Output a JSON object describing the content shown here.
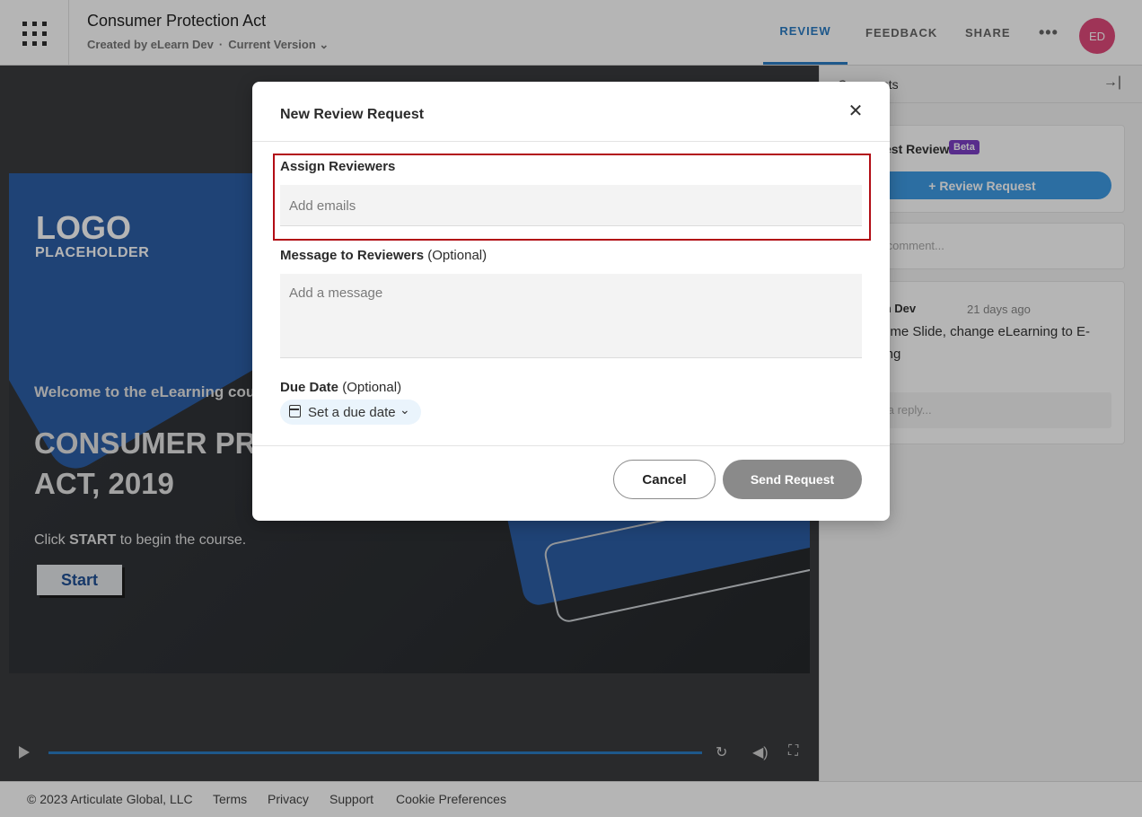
{
  "header": {
    "title": "Consumer Protection Act",
    "created_by": "Created by eLearn Dev",
    "separator": "·",
    "version": "Current Version",
    "tabs": [
      "REVIEW",
      "FEEDBACK",
      "SHARE"
    ],
    "more": "•••",
    "avatar": "ED"
  },
  "slide": {
    "logo_line1": "LOGO",
    "logo_line2": "PLACEHOLDER",
    "welcome": "Welcome to the eLearning course",
    "course_title_line1": "CONSUMER PROTECTION",
    "course_title_line2": "ACT, 2019",
    "click_prefix": "Click ",
    "click_bold": "START",
    "click_suffix": " to begin the course.",
    "start_button": "Start"
  },
  "panel": {
    "header": "Comments",
    "review_title": "Request Review",
    "beta": "Beta",
    "review_button": "+ Review Request",
    "comment_placeholder": "Add a comment...",
    "thread": {
      "author": "eLearn Dev",
      "time": "21 days ago",
      "text": "Welcome Slide, change eLearning to E-learning",
      "reply_placeholder": "Add a reply..."
    }
  },
  "modal": {
    "title": "New Review Request",
    "close": "✕",
    "assign_label": "Assign Reviewers",
    "assign_placeholder": "Add emails",
    "message_label": "Message to Reviewers",
    "message_optional": "(Optional)",
    "message_placeholder": "Add a message",
    "due_label": "Due Date",
    "due_optional": "(Optional)",
    "due_button": "Set a due date",
    "cancel": "Cancel",
    "send": "Send Request"
  },
  "footer": {
    "copyright": "© 2023 Articulate Global, LLC",
    "links": [
      "Terms",
      "Privacy",
      "Support",
      "Cookie Preferences"
    ]
  },
  "colors": {
    "accent": "#2b7cc4",
    "highlight_border": "#b20d15",
    "beta_badge": "#7c3fc6",
    "avatar": "#e04a7b"
  }
}
